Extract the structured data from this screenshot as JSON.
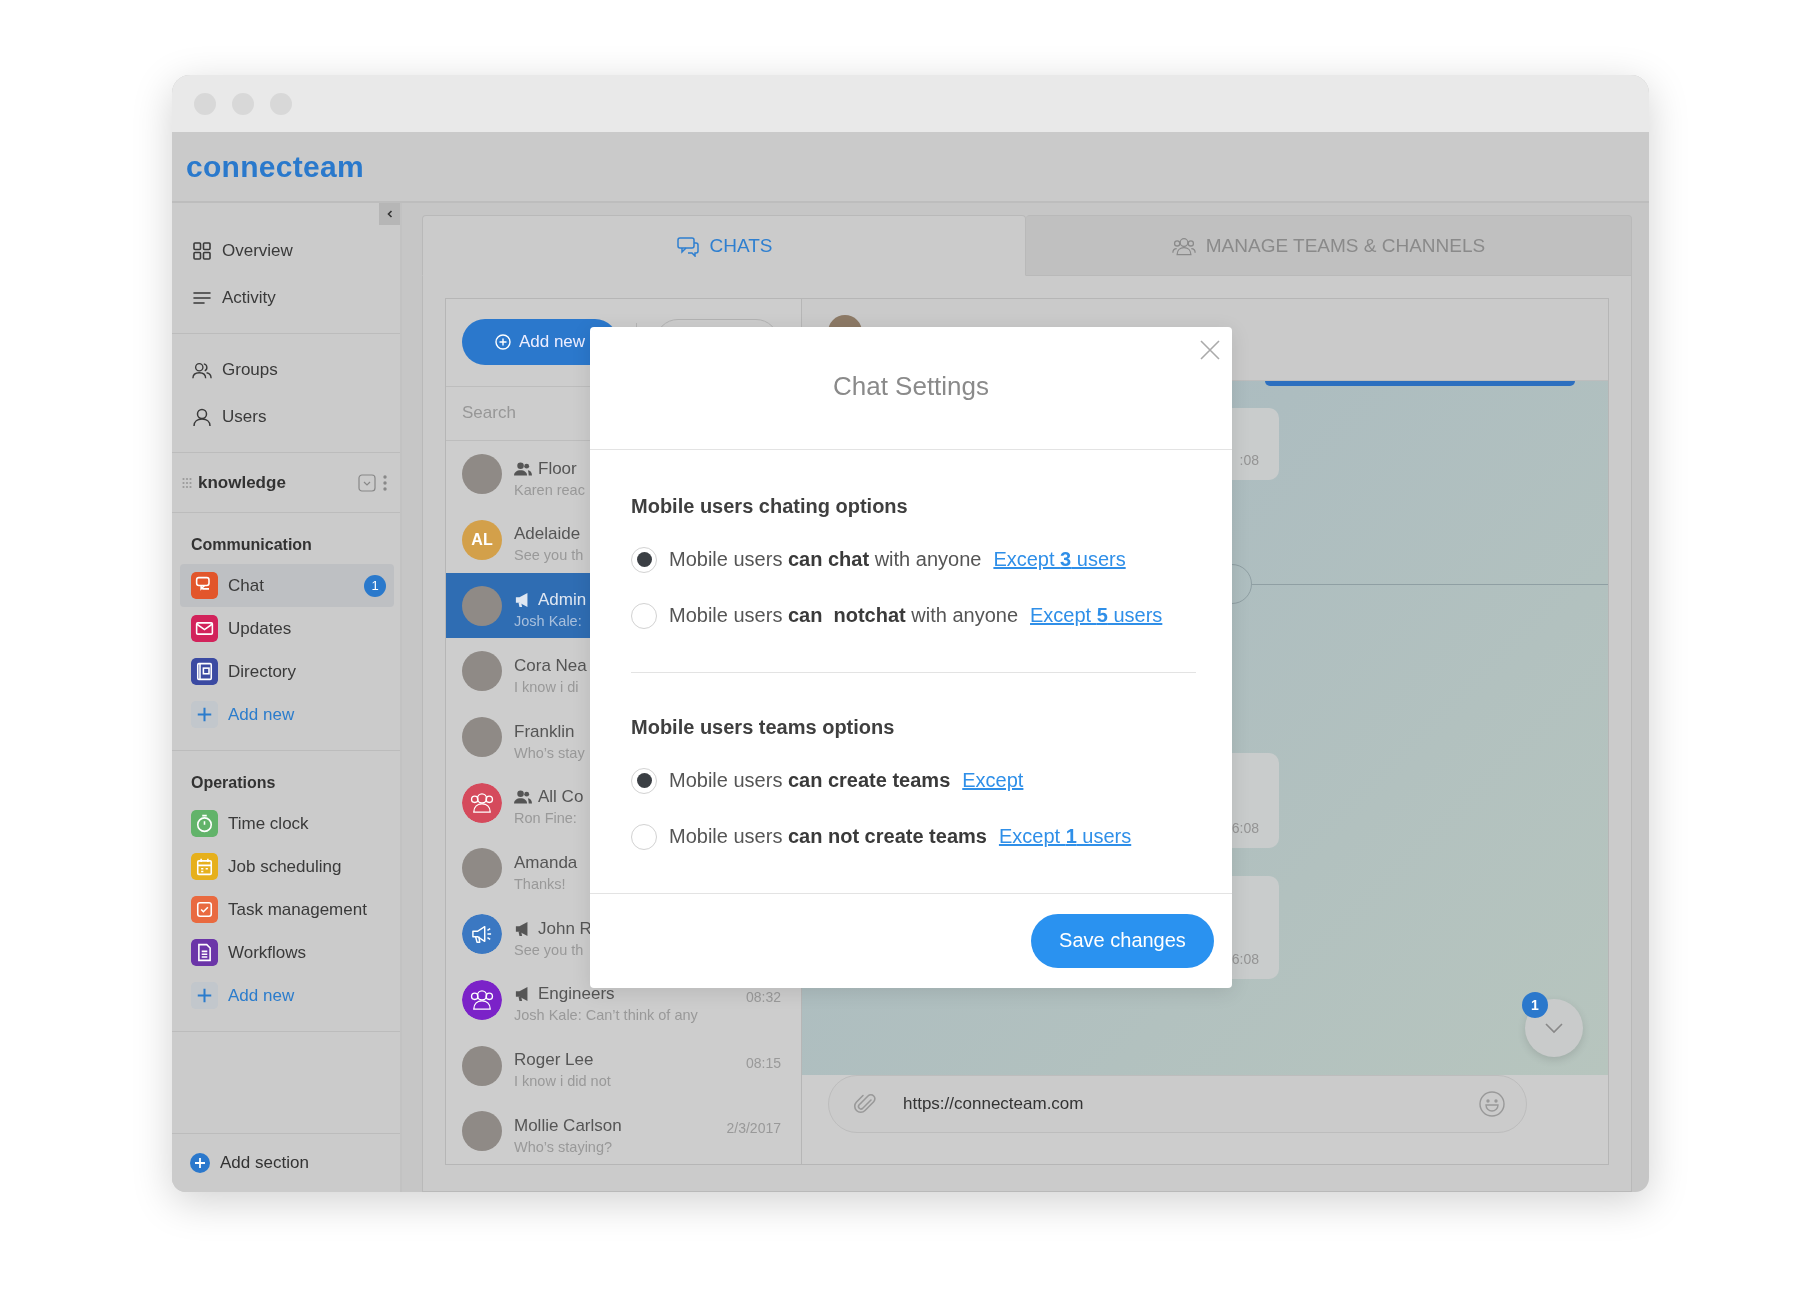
{
  "window": {
    "logo": "connecteam"
  },
  "sidebar": {
    "nav_groups": [
      [
        {
          "label": "Overview"
        },
        {
          "label": "Activity"
        }
      ],
      [
        {
          "label": "Groups"
        },
        {
          "label": "Users"
        }
      ]
    ],
    "workspace": "knowledge",
    "sections": [
      {
        "title": "Communication",
        "add_label": "Add new",
        "apps": [
          {
            "label": "Chat",
            "color": "#e2562b",
            "selected": true,
            "badge": "1"
          },
          {
            "label": "Updates",
            "color": "#d2235b",
            "selected": false
          },
          {
            "label": "Directory",
            "color": "#3b4aa2",
            "selected": false
          }
        ]
      },
      {
        "title": "Operations",
        "add_label": "Add new",
        "apps": [
          {
            "label": "Time clock",
            "color": "#62b36a",
            "selected": false
          },
          {
            "label": "Job scheduling",
            "color": "#e6b01c",
            "selected": false
          },
          {
            "label": "Task management",
            "color": "#e96a40",
            "selected": false
          },
          {
            "label": "Workflows",
            "color": "#6b35a8",
            "selected": false
          }
        ]
      }
    ],
    "add_section": "Add section"
  },
  "tabs": [
    {
      "label": "CHATS",
      "selected": true
    },
    {
      "label": "MANAGE TEAMS & CHANNELS",
      "selected": false
    }
  ],
  "chat_list": {
    "add_button": "Add new",
    "search": {
      "placeholder": "Search"
    },
    "chats": [
      {
        "name": "Floor",
        "preview": "Karen reac",
        "kind": "group",
        "selected": false
      },
      {
        "name": "Adelaide",
        "preview": "See you th",
        "kind": "direct",
        "initials": "AL",
        "color": "#d3a04a",
        "selected": false
      },
      {
        "name": "Admin",
        "preview": "Josh Kale:",
        "kind": "announcement",
        "selected": true
      },
      {
        "name": "Cora Nea",
        "preview": "I know i di",
        "kind": "direct",
        "selected": false
      },
      {
        "name": "Franklin",
        "preview": "Who’s stay",
        "kind": "direct",
        "selected": false
      },
      {
        "name": "All Co",
        "preview": "Ron Fine:",
        "kind": "group",
        "color": "#d54a5c",
        "selected": false
      },
      {
        "name": "Amanda",
        "preview": "Thanks!",
        "kind": "direct",
        "selected": false
      },
      {
        "name": "John R",
        "preview": "See you th",
        "kind": "announcement",
        "color": "#3b78c2",
        "selected": false
      },
      {
        "name": "Engineers",
        "preview": "Josh Kale: Can’t think of any",
        "time": "08:32",
        "kind": "announcement",
        "color": "#7b22c8",
        "selected": false
      },
      {
        "name": "Roger Lee",
        "preview": "I know i did not",
        "time": "08:15",
        "kind": "direct",
        "selected": false
      },
      {
        "name": "Mollie Carlson",
        "preview": "Who’s staying?",
        "time": "2/3/2017",
        "kind": "direct",
        "selected": false
      }
    ]
  },
  "conversation": {
    "bubbles": [
      {
        "time": ":08"
      },
      {
        "time": "6:08"
      },
      {
        "time": "6:08"
      }
    ],
    "unread_badge": "1",
    "composer": {
      "value": "https://connecteam.com"
    }
  },
  "dialog": {
    "title": "Chat Settings",
    "groups": [
      {
        "heading": "Mobile users chating options",
        "options": [
          {
            "text": "Mobile users **can chat** with anyone",
            "link": "Except **3** users",
            "selected": true
          },
          {
            "text": "Mobile users **can  notchat** with anyone",
            "link": "Except **5** users",
            "selected": false
          }
        ]
      },
      {
        "heading": "Mobile users teams options",
        "options": [
          {
            "text": "Mobile users **can create teams**",
            "link": "Except",
            "selected": true
          },
          {
            "text": "Mobile users **can not create teams**",
            "link": "Except **1** users",
            "selected": false
          }
        ]
      }
    ],
    "save_button": "Save changes"
  }
}
